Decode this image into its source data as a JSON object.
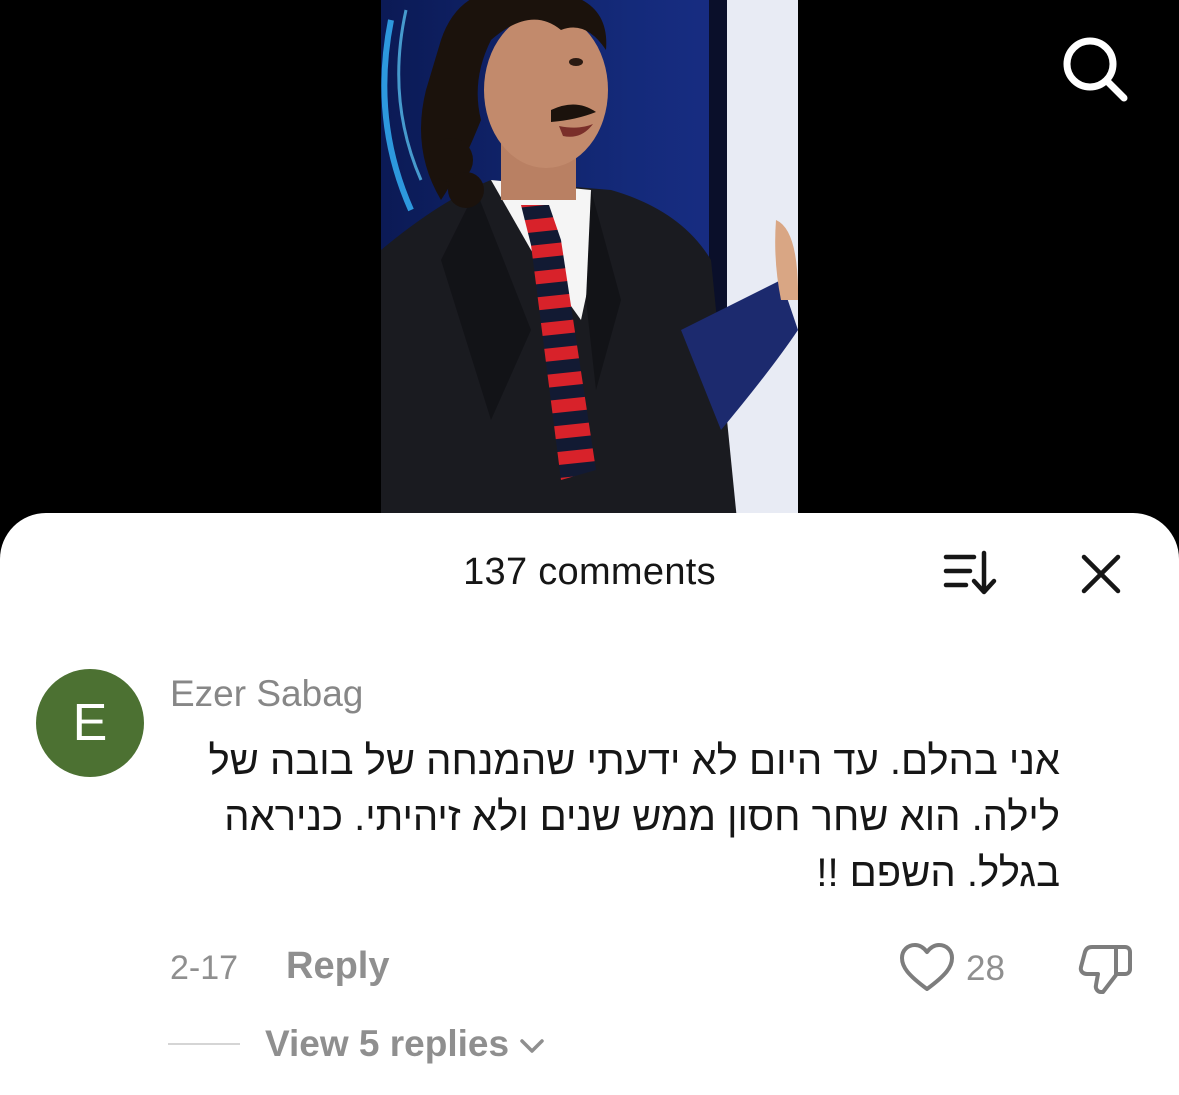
{
  "video": {
    "icons": {
      "search": "search-icon"
    }
  },
  "comments_panel": {
    "title": "137 comments",
    "icons": {
      "sort": "sort-icon",
      "close": "close-icon"
    }
  },
  "comment": {
    "avatar_letter": "E",
    "avatar_color": "#4c7132",
    "author": "Ezer Sabag",
    "text_lines": [
      "אני בהלם. עד היום לא ידעתי שהמנחה של בובה של",
      "לילה. הוא שחר חסון ממש שנים ולא זיהיתי. כניראה",
      "בגלל. השפם !!"
    ],
    "date": "2-17",
    "reply_label": "Reply",
    "like_count": "28",
    "view_replies_label": "View 5 replies",
    "icons": {
      "like": "heart-icon",
      "dislike": "thumbs-down-icon",
      "expand": "chevron-down-icon"
    }
  }
}
